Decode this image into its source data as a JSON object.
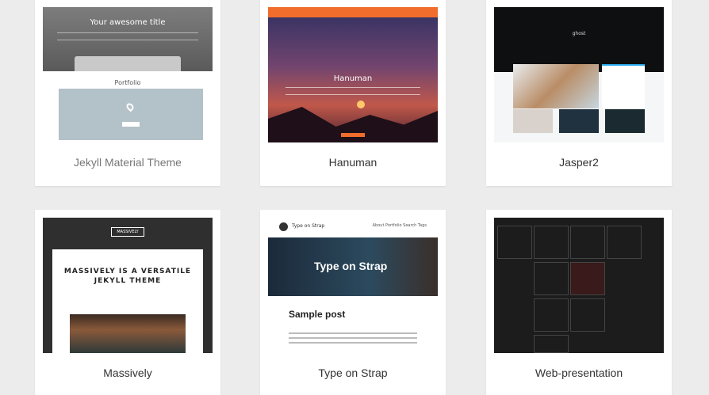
{
  "themes": [
    {
      "name": "Jekyll Material Theme",
      "preview_title": "Your awesome title",
      "preview_section": "Portfolio"
    },
    {
      "name": "Hanuman",
      "preview_brand": "HANUMAN",
      "preview_title": "Hanuman"
    },
    {
      "name": "Jasper2",
      "preview_brand": "ghost"
    },
    {
      "name": "Massively",
      "preview_logo": "MASSIVELY",
      "preview_heading": "MASSIVELY IS A VERSATILE JEKYLL THEME"
    },
    {
      "name": "Type on Strap",
      "preview_brand": "Type on Strap",
      "preview_nav": "About  Portfolio  Search  Tags",
      "preview_post": "Sample post"
    },
    {
      "name": "Web-presentation"
    }
  ],
  "colors": {
    "page_bg": "#ececec",
    "hanuman_orange": "#f06d2b",
    "jasper_blue": "#26a8ed"
  }
}
